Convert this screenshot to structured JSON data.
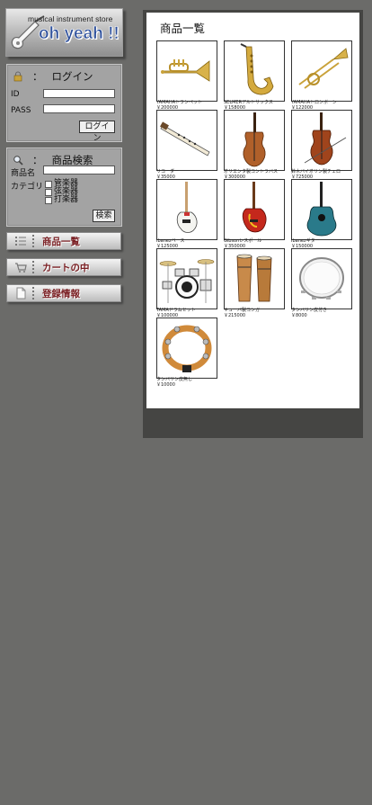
{
  "logo": {
    "store_text": "musical instrument store",
    "brand_text": "oh yeah !!"
  },
  "login": {
    "icon": "lock-icon",
    "colon": "：",
    "title": "ログイン",
    "id_label": "ID",
    "pass_label": "PASS",
    "id_value": "",
    "pass_value": "",
    "button": "ログイン"
  },
  "search": {
    "icon": "magnifier-icon",
    "colon": "：",
    "title": "商品検索",
    "name_label": "商品名",
    "name_value": "",
    "category_label": "カテゴリ",
    "categories": [
      "管楽器",
      "弦楽器",
      "打楽器"
    ],
    "button": "検索"
  },
  "nav": [
    {
      "label": "商品一覧",
      "icon": "list-icon"
    },
    {
      "label": "カートの中",
      "icon": "cart-icon"
    },
    {
      "label": "登録情報",
      "icon": "document-icon"
    }
  ],
  "main": {
    "title": "商品一覧",
    "products": [
      {
        "name": "YAMAHAトランペット",
        "price": "￥200000",
        "icon": "trumpet-icon"
      },
      {
        "name": "SELMERアルトサックス",
        "price": "￥158000",
        "icon": "saxophone-icon"
      },
      {
        "name": "YAMAHAトロンボーン",
        "price": "￥122000",
        "icon": "trombone-icon"
      },
      {
        "name": "リコーダー",
        "price": "￥35000",
        "icon": "recorder-icon"
      },
      {
        "name": "オリエンタ製コントラバス",
        "price": "￥300000",
        "icon": "contrabass-icon"
      },
      {
        "name": "鈴木バイオリン製チェロ",
        "price": "￥725000",
        "icon": "cello-icon"
      },
      {
        "name": "Ibanezベース",
        "price": "￥125000",
        "icon": "bass-guitar-icon"
      },
      {
        "name": "Gibsonレスポール",
        "price": "￥350000",
        "icon": "electric-guitar-icon"
      },
      {
        "name": "Ibanezギター",
        "price": "￥150000",
        "icon": "acoustic-guitar-icon"
      },
      {
        "name": "TAMAドラムセット",
        "price": "￥100000",
        "icon": "drum-set-icon"
      },
      {
        "name": "キューバ製コンガ",
        "price": "￥215000",
        "icon": "conga-icon"
      },
      {
        "name": "タンバリン皮付き",
        "price": "￥8000",
        "icon": "tambourine-skin-icon"
      },
      {
        "name": "タンバリン皮無し",
        "price": "￥10000",
        "icon": "tambourine-icon"
      }
    ]
  },
  "colors": {
    "background": "#6b6b69",
    "frame": "#454543",
    "panel": "#a3a3a3",
    "nav_text": "#7a1f23",
    "brand_blue": "#2b4e9b"
  }
}
